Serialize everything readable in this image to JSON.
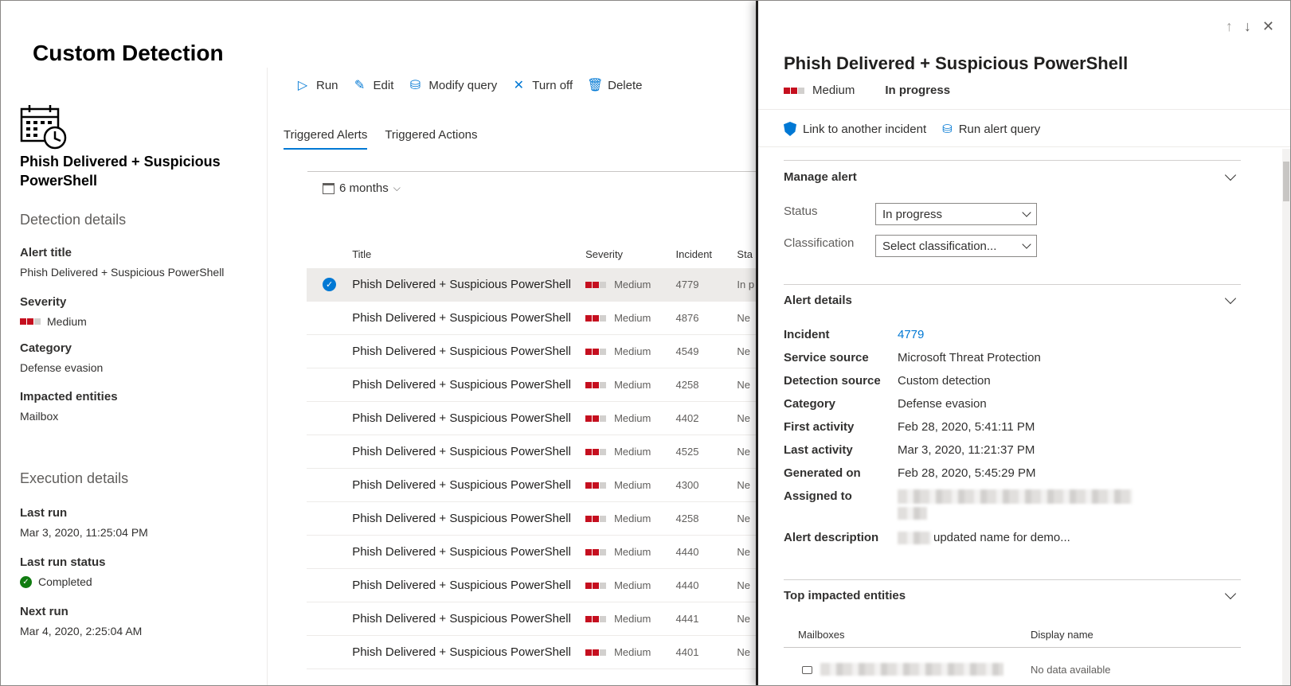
{
  "page": {
    "title": "Custom Detection"
  },
  "rule": {
    "name": "Phish Delivered + Suspicious PowerShell"
  },
  "detection_details": {
    "heading": "Detection details",
    "alert_title_label": "Alert title",
    "alert_title_value": "Phish Delivered + Suspicious PowerShell",
    "severity_label": "Severity",
    "severity_value": "Medium",
    "category_label": "Category",
    "category_value": "Defense evasion",
    "entities_label": "Impacted entities",
    "entities_value": "Mailbox"
  },
  "execution_details": {
    "heading": "Execution details",
    "last_run_label": "Last run",
    "last_run_value": "Mar 3, 2020, 11:25:04 PM",
    "last_run_status_label": "Last run status",
    "last_run_status_value": "Completed",
    "next_run_label": "Next run",
    "next_run_value": "Mar 4, 2020, 2:25:04 AM"
  },
  "toolbar": {
    "run": "Run",
    "edit": "Edit",
    "modify_query": "Modify query",
    "turn_off": "Turn off",
    "delete": "Delete"
  },
  "tabs": {
    "triggered_alerts": "Triggered Alerts",
    "triggered_actions": "Triggered Actions"
  },
  "filter": {
    "range": "6 months"
  },
  "grid": {
    "headers": {
      "title": "Title",
      "severity": "Severity",
      "incident": "Incident",
      "status": "Sta"
    },
    "rows": [
      {
        "title": "Phish Delivered + Suspicious PowerShell",
        "severity": "Medium",
        "incident": "4779",
        "status": "In p"
      },
      {
        "title": "Phish Delivered + Suspicious PowerShell",
        "severity": "Medium",
        "incident": "4876",
        "status": "Ne"
      },
      {
        "title": "Phish Delivered + Suspicious PowerShell",
        "severity": "Medium",
        "incident": "4549",
        "status": "Ne"
      },
      {
        "title": "Phish Delivered + Suspicious PowerShell",
        "severity": "Medium",
        "incident": "4258",
        "status": "Ne"
      },
      {
        "title": "Phish Delivered + Suspicious PowerShell",
        "severity": "Medium",
        "incident": "4402",
        "status": "Ne"
      },
      {
        "title": "Phish Delivered + Suspicious PowerShell",
        "severity": "Medium",
        "incident": "4525",
        "status": "Ne"
      },
      {
        "title": "Phish Delivered + Suspicious PowerShell",
        "severity": "Medium",
        "incident": "4300",
        "status": "Ne"
      },
      {
        "title": "Phish Delivered + Suspicious PowerShell",
        "severity": "Medium",
        "incident": "4258",
        "status": "Ne"
      },
      {
        "title": "Phish Delivered + Suspicious PowerShell",
        "severity": "Medium",
        "incident": "4440",
        "status": "Ne"
      },
      {
        "title": "Phish Delivered + Suspicious PowerShell",
        "severity": "Medium",
        "incident": "4440",
        "status": "Ne"
      },
      {
        "title": "Phish Delivered + Suspicious PowerShell",
        "severity": "Medium",
        "incident": "4441",
        "status": "Ne"
      },
      {
        "title": "Phish Delivered + Suspicious PowerShell",
        "severity": "Medium",
        "incident": "4401",
        "status": "Ne"
      }
    ]
  },
  "panel": {
    "title": "Phish Delivered + Suspicious PowerShell",
    "severity": "Medium",
    "status": "In progress",
    "actions": {
      "link": "Link to another incident",
      "run_query": "Run alert query"
    },
    "manage": {
      "heading": "Manage alert",
      "status_label": "Status",
      "status_value": "In progress",
      "classification_label": "Classification",
      "classification_placeholder": "Select classification..."
    },
    "details": {
      "heading": "Alert details",
      "incident_label": "Incident",
      "incident_value": "4779",
      "service_source_label": "Service source",
      "service_source_value": "Microsoft Threat Protection",
      "detection_source_label": "Detection source",
      "detection_source_value": "Custom detection",
      "category_label": "Category",
      "category_value": "Defense evasion",
      "first_activity_label": "First activity",
      "first_activity_value": "Feb 28, 2020, 5:41:11 PM",
      "last_activity_label": "Last activity",
      "last_activity_value": "Mar 3, 2020, 11:21:37 PM",
      "generated_on_label": "Generated on",
      "generated_on_value": "Feb 28, 2020, 5:45:29 PM",
      "assigned_to_label": "Assigned to",
      "description_label": "Alert description",
      "description_value": "updated name for demo..."
    },
    "entities": {
      "heading": "Top impacted entities",
      "col_mailboxes": "Mailboxes",
      "col_display_name": "Display name",
      "display_name_value": "No data available"
    }
  }
}
